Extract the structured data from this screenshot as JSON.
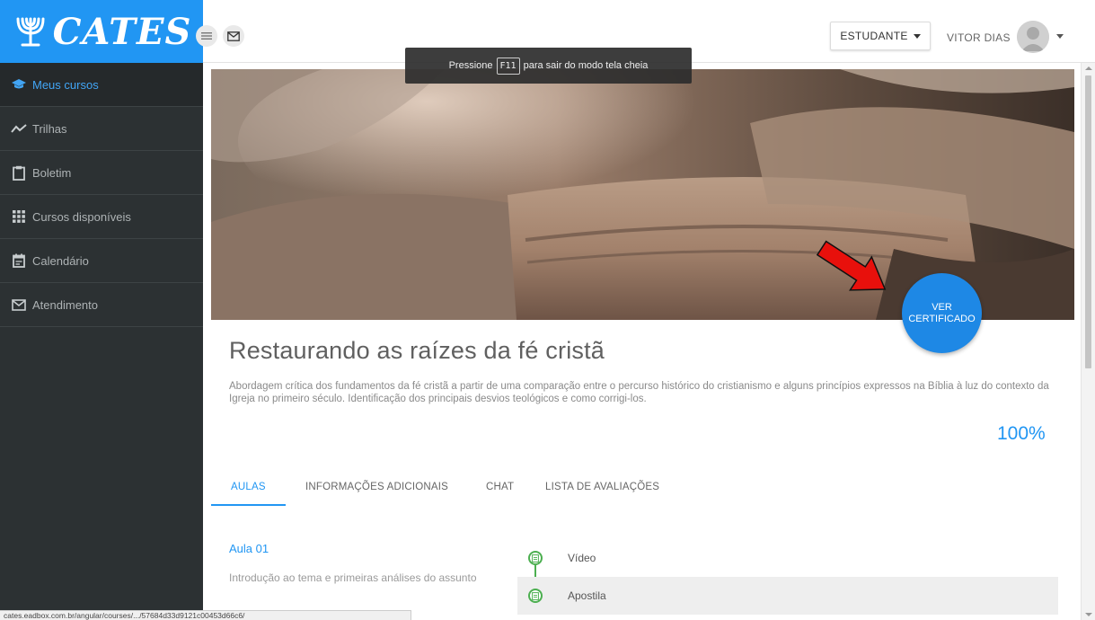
{
  "brand": {
    "logo_text": "CATES",
    "accent": "#2196f3",
    "sidebar_bg": "#2c3133"
  },
  "sidebar": {
    "items": [
      {
        "label": "Meus cursos",
        "icon": "graduation-cap-icon",
        "active": true
      },
      {
        "label": "Trilhas",
        "icon": "trend-line-icon",
        "active": false
      },
      {
        "label": "Boletim",
        "icon": "clipboard-icon",
        "active": false
      },
      {
        "label": "Cursos disponíveis",
        "icon": "grid-icon",
        "active": false
      },
      {
        "label": "Calendário",
        "icon": "calendar-icon",
        "active": false
      },
      {
        "label": "Atendimento",
        "icon": "mail-icon",
        "active": false
      }
    ]
  },
  "header": {
    "menu_icon": "hamburger-icon",
    "messages_icon": "mail-icon",
    "role": "ESTUDANTE",
    "user_name": "VITOR DIAS"
  },
  "fullscreen_notice": {
    "before": "Pressione",
    "key": "F11",
    "after": "para sair do modo tela cheia"
  },
  "course": {
    "title": "Restaurando as raízes da fé cristã",
    "description": "Abordagem crítica dos fundamentos da fé cristã a partir de uma comparação entre o percurso histórico do cristianismo e alguns princípios expressos na Bíblia à luz do contexto da Igreja no primeiro século. Identificação dos principais desvios teológicos e como corrigi-los.",
    "progress": "100%",
    "certificate_button": {
      "line1": "VER",
      "line2": "CERTIFICADO"
    }
  },
  "tabs": [
    {
      "label": "AULAS",
      "active": true
    },
    {
      "label": "INFORMAÇÕES ADICIONAIS",
      "active": false
    },
    {
      "label": "CHAT",
      "active": false
    },
    {
      "label": "LISTA DE AVALIAÇÕES",
      "active": false
    }
  ],
  "lesson": {
    "title": "Aula 01",
    "description": "Introdução ao tema e primeiras análises do assunto",
    "items": [
      {
        "label": "Vídeo",
        "icon": "document-icon",
        "status_color": "#4caf50"
      },
      {
        "label": "Apostila",
        "icon": "document-icon",
        "status_color": "#4caf50"
      }
    ]
  },
  "status_bar": {
    "url": "cates.eadbox.com.br/angular/courses/.../57684d33d9121c00453d66c6/"
  }
}
